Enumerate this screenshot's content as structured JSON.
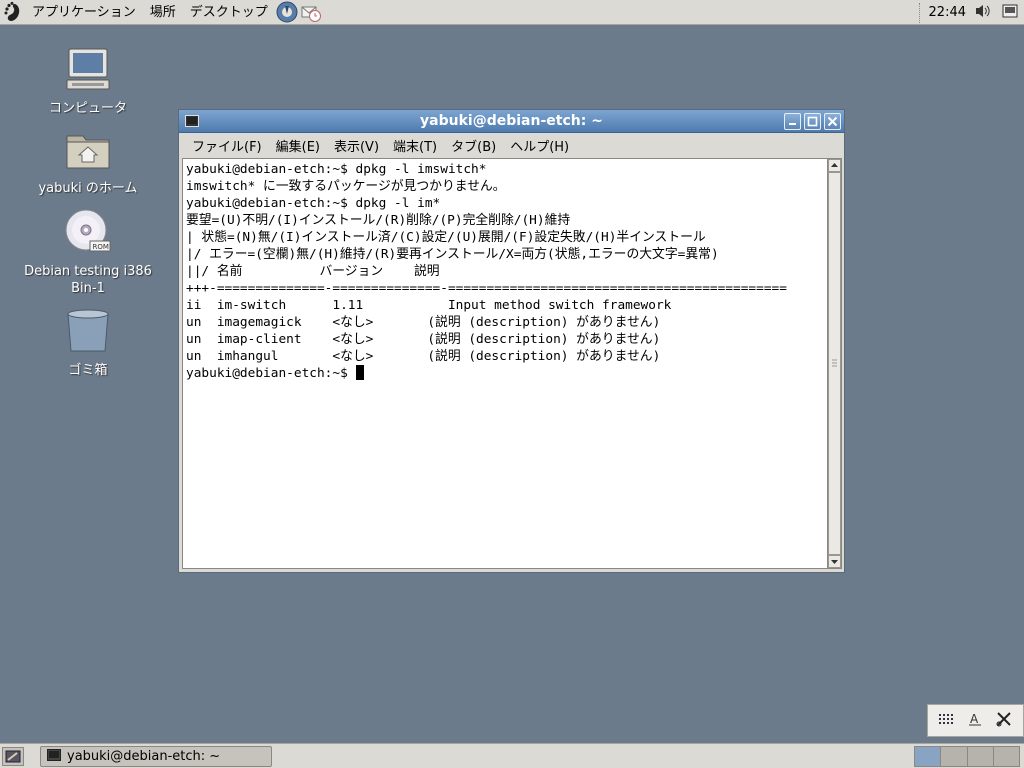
{
  "top_panel": {
    "menus": [
      "アプリケーション",
      "場所",
      "デスクトップ"
    ],
    "clock": "22:44",
    "launchers": [
      "help-icon",
      "mail-clock-icon"
    ]
  },
  "desktop": {
    "icons": [
      {
        "label": "コンピュータ",
        "icon": "computer-icon"
      },
      {
        "label": "yabuki のホーム",
        "icon": "home-folder-icon"
      },
      {
        "label": "Debian testing i386 Bin-1",
        "icon": "cdrom-icon"
      },
      {
        "label": "ゴミ箱",
        "icon": "trash-icon"
      }
    ]
  },
  "terminal": {
    "title": "yabuki@debian-etch: ~",
    "menu": [
      "ファイル(F)",
      "編集(E)",
      "表示(V)",
      "端末(T)",
      "タブ(B)",
      "ヘルプ(H)"
    ],
    "lines": [
      "yabuki@debian-etch:~$ dpkg -l imswitch*",
      "imswitch* に一致するパッケージが見つかりません。",
      "yabuki@debian-etch:~$ dpkg -l im*",
      "要望=(U)不明/(I)インストール/(R)削除/(P)完全削除/(H)維持",
      "| 状態=(N)無/(I)インストール済/(C)設定/(U)展開/(F)設定失敗/(H)半インストール",
      "|/ エラー=(空欄)無/(H)維持/(R)要再インストール/X=両方(状態,エラーの大文字=異常)",
      "||/ 名前          バージョン    説明",
      "+++-==============-==============-============================================",
      "ii  im-switch      1.11           Input method switch framework",
      "un  imagemagick    <なし>       (説明 (description) がありません)",
      "un  imap-client    <なし>       (説明 (description) がありません)",
      "un  imhangul       <なし>       (説明 (description) がありません)"
    ],
    "prompt": "yabuki@debian-etch:~$ "
  },
  "taskbar": {
    "task_label": "yabuki@debian-etch: ~",
    "workspaces": 4,
    "active_workspace": 1
  },
  "colors": {
    "desktop": "#6b7b8b",
    "titlebar": "#5b87ba",
    "panel": "#dcdad5"
  }
}
